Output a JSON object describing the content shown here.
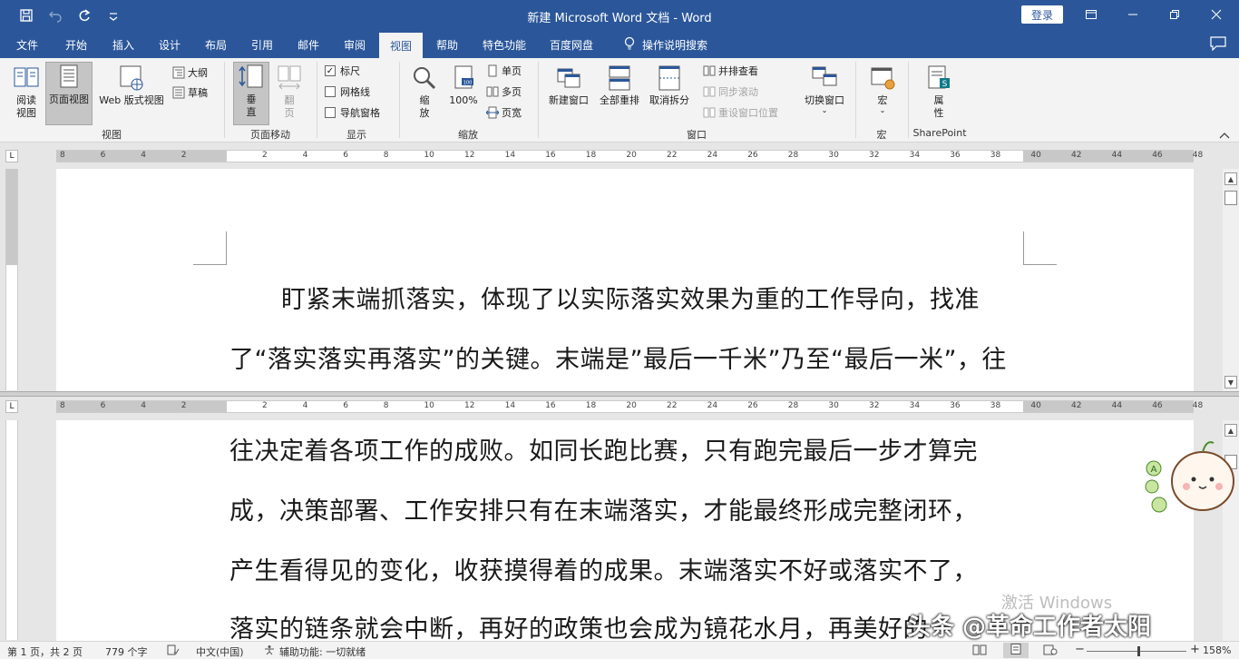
{
  "title_bar": {
    "title": "新建 Microsoft Word 文档  -  Word",
    "login_label": "登录"
  },
  "menu_tabs": [
    "文件",
    "开始",
    "插入",
    "设计",
    "布局",
    "引用",
    "邮件",
    "审阅",
    "视图",
    "帮助",
    "特色功能",
    "百度网盘",
    "操作说明搜索"
  ],
  "active_tab": "视图",
  "ribbon": {
    "views": {
      "read_mode": "阅读\n视图",
      "print_layout": "页面视图",
      "web_layout": "Web 版式视图",
      "outline": "大纲",
      "draft": "草稿",
      "group_label": "视图"
    },
    "page_movement": {
      "vertical": "垂\n直",
      "side_to_side": "翻\n页",
      "group_label": "页面移动"
    },
    "show": {
      "ruler": "标尺",
      "gridlines": "网格线",
      "nav_pane": "导航窗格",
      "ruler_checked": true,
      "gridlines_checked": false,
      "nav_pane_checked": false,
      "group_label": "显示"
    },
    "zoom": {
      "zoom": "缩\n放",
      "hundred": "100%",
      "one_page": "单页",
      "multi_page": "多页",
      "page_width": "页宽",
      "group_label": "缩放"
    },
    "window": {
      "new_window": "新建窗口",
      "arrange_all": "全部重排",
      "remove_split": "取消拆分",
      "side_by_side": "并排查看",
      "sync_scroll": "同步滚动",
      "reset_position": "重设窗口位置",
      "switch_windows": "切换窗口",
      "group_label": "窗口"
    },
    "macros": {
      "macros": "宏",
      "group_label": "宏"
    },
    "sharepoint": {
      "properties": "属\n性",
      "group_label": "SharePoint"
    }
  },
  "ruler_numbers": [
    "8",
    "6",
    "4",
    "2",
    "",
    "2",
    "4",
    "6",
    "8",
    "10",
    "12",
    "14",
    "16",
    "18",
    "20",
    "22",
    "24",
    "26",
    "28",
    "30",
    "32",
    "34",
    "36",
    "38",
    "40",
    "42",
    "44",
    "46",
    "48"
  ],
  "document": {
    "top_pane_lines": [
      "盯紧末端抓落实，体现了以实际落实效果为重的工作导向，找准",
      "了“落实落实再落实”的关键。末端是”最后一千米”乃至“最后一米”，往"
    ],
    "bottom_pane_lines": [
      "往决定着各项工作的成败。如同长跑比赛，只有跑完最后一步才算完",
      "成，决策部署、工作安排只有在末端落实，才能最终形成完整闭环，",
      "产生看得见的变化，收获摸得着的成果。末端落实不好或落实不了，",
      "落实的链条就会中断，再好的政策也会成为镜花水月，再美好的"
    ]
  },
  "status_bar": {
    "page": "第 1 页，共 2 页",
    "words": "779 个字",
    "language": "中文(中国)",
    "accessibility": "辅助功能: 一切就绪",
    "zoom": "158%",
    "zoom_minus": "−",
    "zoom_plus": "+"
  },
  "overlay": {
    "activate_windows": "激活 Windows",
    "watermark": "头条 @革命工作者太阳"
  },
  "colors": {
    "title_bar": "#2b579a",
    "ribbon_bg": "#f3f3f3",
    "workspace_bg": "#e6e6e6"
  }
}
